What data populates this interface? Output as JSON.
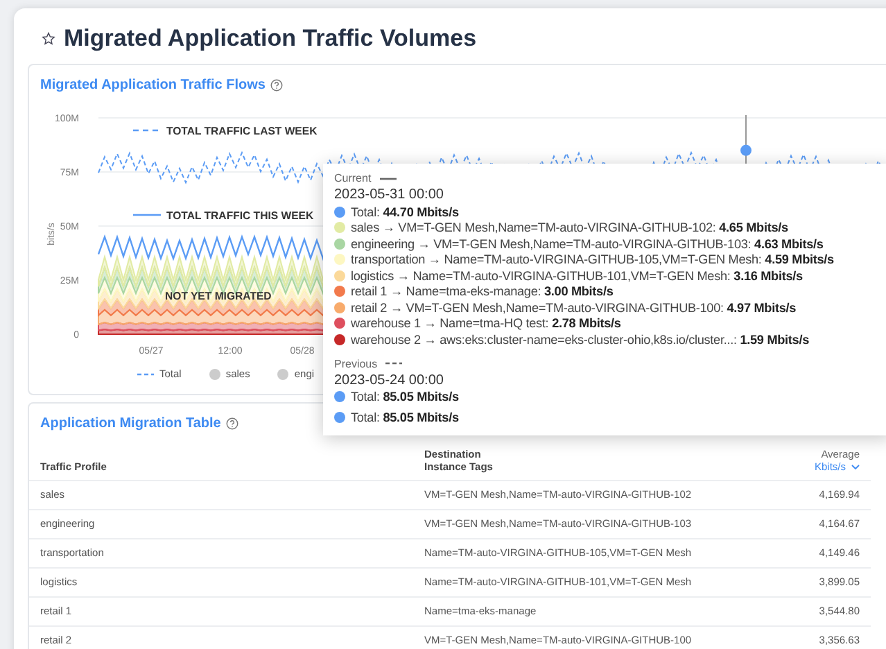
{
  "page": {
    "title": "Migrated Application Traffic Volumes",
    "favorite": false
  },
  "chart_panel": {
    "title": "Migrated Application Traffic Flows",
    "y_axis_label": "bits/s",
    "y_ticks": [
      "100M",
      "75M",
      "50M",
      "25M",
      "0"
    ],
    "x_ticks": [
      "05/27",
      "12:00",
      "05/28"
    ],
    "annotations": [
      {
        "text": "TOTAL TRAFFIC LAST WEEK",
        "kind": "dashed"
      },
      {
        "text": "TOTAL TRAFFIC THIS WEEK",
        "kind": "solid"
      },
      {
        "text": "NOT YET MIGRATED",
        "kind": "plain"
      }
    ],
    "legend": [
      {
        "label": "Total",
        "kind": "line"
      },
      {
        "label": "sales",
        "kind": "dot"
      },
      {
        "label": "engi",
        "kind": "dot"
      }
    ]
  },
  "tooltip": {
    "sections": [
      {
        "label": "Current",
        "kind": "solid",
        "date": "2023-05-31 00:00",
        "items": [
          {
            "text": "Total: **44.70 Mbits/s**",
            "color": "#5b9cf5"
          },
          {
            "text": "sales → VM=T-GEN Mesh,Name=TM-auto-VIRGINA-GITHUB-102: **4.65 Mbits/s**",
            "color": "#e2eba4"
          },
          {
            "text": "engineering → VM=T-GEN Mesh,Name=TM-auto-VIRGINA-GITHUB-103: **4.63 Mbits/s**",
            "color": "#a9d6a3"
          },
          {
            "text": "transportation → Name=TM-auto-VIRGINA-GITHUB-105,VM=T-GEN Mesh: **4.59 Mbits/s**",
            "color": "#fdf7c2"
          },
          {
            "text": "logistics → Name=TM-auto-VIRGINA-GITHUB-101,VM=T-GEN Mesh: **3.16 Mbits/s**",
            "color": "#fbd99a"
          },
          {
            "text": "retail 1 → Name=tma-eks-manage: **3.00 Mbits/s**",
            "color": "#f27a4c"
          },
          {
            "text": "retail 2 → VM=T-GEN Mesh,Name=TM-auto-VIRGINA-GITHUB-100: **4.97 Mbits/s**",
            "color": "#f8ab6c"
          },
          {
            "text": "warehouse 1 → Name=tma-HQ test: **2.78 Mbits/s**",
            "color": "#de4f5e"
          },
          {
            "text": "warehouse 2 → aws:eks:cluster-name=eks-cluster-ohio,k8s.io/cluster...: **1.59 Mbits/s**",
            "color": "#c62828"
          }
        ]
      },
      {
        "label": "Previous",
        "kind": "dashed",
        "date": "2023-05-24 00:00",
        "items": [
          {
            "text": "Total: **85.05 Mbits/s**",
            "color": "#5b9cf5"
          }
        ]
      }
    ],
    "extra_items": [
      {
        "text": "Total: **85.05 Mbits/s**",
        "color": "#5b9cf5"
      }
    ]
  },
  "table_panel": {
    "title": "Application Migration Table",
    "columns": [
      {
        "label": "Traffic Profile"
      },
      {
        "label": "Destination Instance Tags"
      },
      {
        "label": "Average",
        "unit": "Kbits/s"
      }
    ],
    "rows": [
      [
        "sales",
        "VM=T-GEN Mesh,Name=TM-auto-VIRGINA-GITHUB-102",
        "4,169.94"
      ],
      [
        "engineering",
        "VM=T-GEN Mesh,Name=TM-auto-VIRGINA-GITHUB-103",
        "4,164.67"
      ],
      [
        "transportation",
        "Name=TM-auto-VIRGINA-GITHUB-105,VM=T-GEN Mesh",
        "4,149.46"
      ],
      [
        "logistics",
        "Name=TM-auto-VIRGINA-GITHUB-101,VM=T-GEN Mesh",
        "3,899.05"
      ],
      [
        "retail 1",
        "Name=tma-eks-manage",
        "3,544.80"
      ],
      [
        "retail 2",
        "VM=T-GEN Mesh,Name=TM-auto-VIRGINA-GITHUB-100",
        "3,356.63"
      ]
    ]
  }
}
